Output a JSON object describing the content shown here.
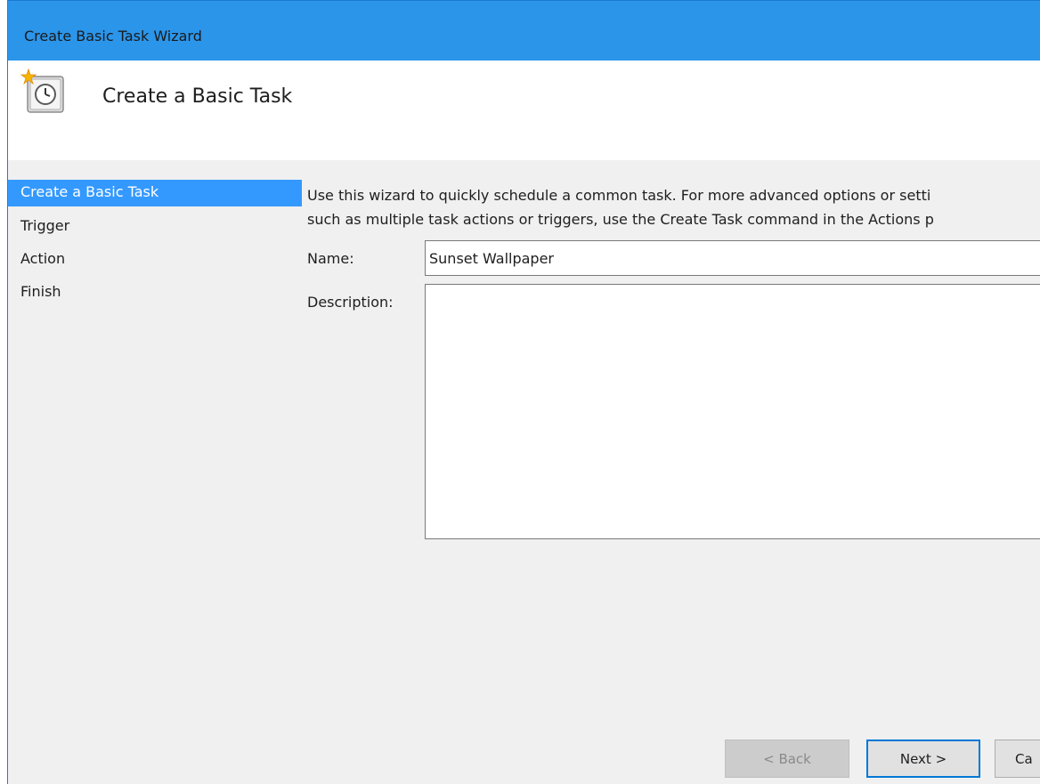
{
  "window": {
    "title": "Create Basic Task Wizard"
  },
  "header": {
    "title": "Create a Basic Task",
    "icon": "scheduled-task-clock-icon"
  },
  "steps": [
    {
      "label": "Create a Basic Task",
      "active": true
    },
    {
      "label": "Trigger",
      "active": false
    },
    {
      "label": "Action",
      "active": false
    },
    {
      "label": "Finish",
      "active": false
    }
  ],
  "intro": {
    "line1": "Use this wizard to quickly schedule a common task.  For more advanced options or setti",
    "line2": "such as multiple task actions or triggers, use the Create Task command in the Actions p"
  },
  "form": {
    "name_label": "Name:",
    "name_value": "Sunset Wallpaper",
    "description_label": "Description:",
    "description_value": ""
  },
  "buttons": {
    "back": "< Back",
    "next": "Next >",
    "cancel": "Ca"
  },
  "colors": {
    "titlebar": "#2b95ea",
    "active_step": "#3399ff",
    "focus_border": "#0078d7"
  }
}
